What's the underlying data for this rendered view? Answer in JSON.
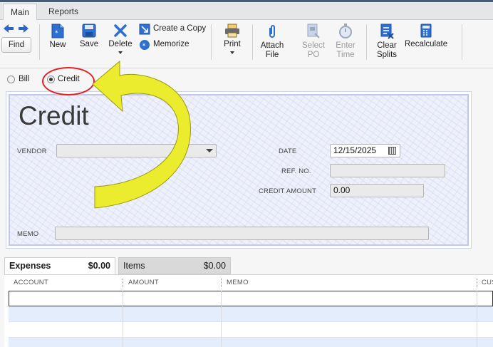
{
  "tabs": {
    "main": "Main",
    "reports": "Reports"
  },
  "toolbar": {
    "find": "Find",
    "new": "New",
    "save": "Save",
    "delete": "Delete",
    "create_copy": "Create a Copy",
    "memorize": "Memorize",
    "print": "Print",
    "attach_file_1": "Attach",
    "attach_file_2": "File",
    "select_po_1": "Select",
    "select_po_2": "PO",
    "enter_time_1": "Enter",
    "enter_time_2": "Time",
    "clear_splits_1": "Clear",
    "clear_splits_2": "Splits",
    "recalculate": "Recalculate"
  },
  "type_selector": {
    "bill": "Bill",
    "credit": "Credit",
    "selected": "credit"
  },
  "form": {
    "title": "Credit",
    "vendor_label": "VENDOR",
    "vendor_value": "",
    "date_label": "DATE",
    "date_value": "12/15/2025",
    "ref_label": "REF. NO.",
    "ref_value": "",
    "credit_amount_label": "CREDIT AMOUNT",
    "credit_amount_value": "0.00",
    "memo_label": "MEMO",
    "memo_value": ""
  },
  "detail_tabs": {
    "expenses": {
      "label": "Expenses",
      "amount": "$0.00"
    },
    "items": {
      "label": "Items",
      "amount": "$0.00"
    }
  },
  "grid": {
    "columns": [
      "ACCOUNT",
      "AMOUNT",
      "MEMO",
      "CUS"
    ]
  },
  "annotation": {
    "circle_color": "#e32020",
    "arrow_color": "#f5f520"
  }
}
